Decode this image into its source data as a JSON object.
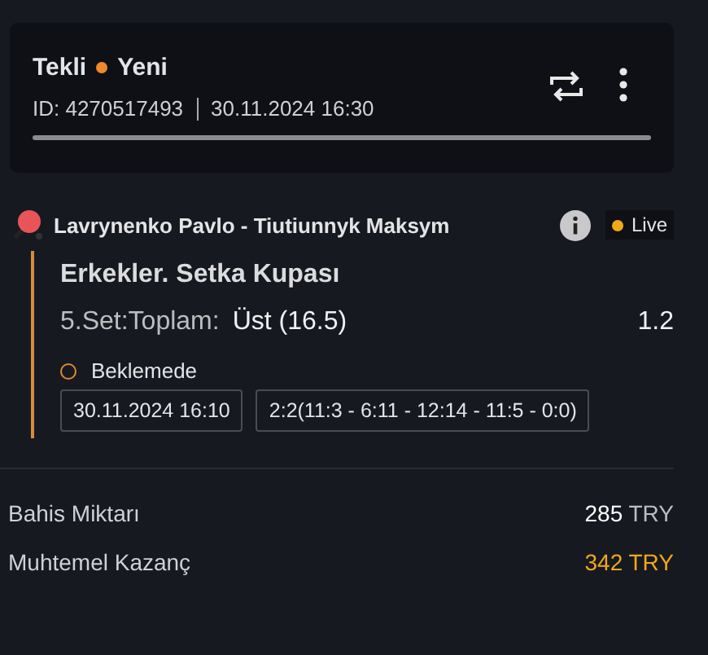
{
  "bet_card": {
    "type": "Tekli",
    "status": "Yeni",
    "id": "ID: 4270517493",
    "placed_at": "30.11.2024 16:30"
  },
  "event": {
    "teams": "Lavrynenko Pavlo - Tiutiunnyk Maksym",
    "live": true,
    "live_label": "Live",
    "tournament": "Erkekler. Setka Kupası",
    "market": "5.Set:Toplam:",
    "selection": "Üst (16.5)",
    "odds": "1.2",
    "state": "Beklemede",
    "start_time": "30.11.2024 16:10",
    "score": "2:2(11:3 - 6:11 - 12:14 - 11:5 - 0:0)"
  },
  "summary": [
    {
      "label": "Bahis Miktarı",
      "value": "**285** TRY",
      "highlight": false
    },
    {
      "label": "Muhtemel Kazanç",
      "value": "342 TRY",
      "highlight": true
    }
  ]
}
